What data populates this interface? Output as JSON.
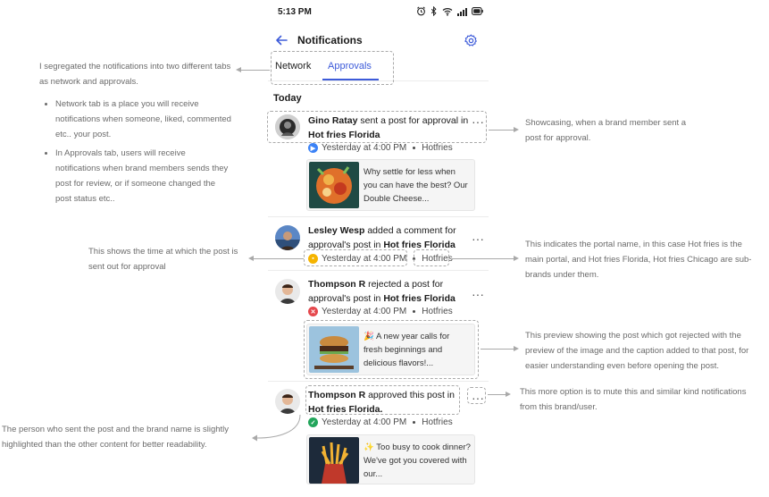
{
  "status_bar": {
    "time": "5:13 PM"
  },
  "header": {
    "title": "Notifications"
  },
  "tabs": [
    {
      "label": "Network"
    },
    {
      "label": "Approvals"
    }
  ],
  "section": {
    "label": "Today"
  },
  "notifications": [
    {
      "name": "Gino Ratay",
      "text_mid": " sent a post for approval in ",
      "brand": "Hot fries Florida",
      "time": "Yesterday at 4:00 PM",
      "portal": "Hotfries",
      "preview": "Why settle for less when you can have the best? Our Double Cheese..."
    },
    {
      "name": "Lesley Wesp",
      "text_mid": " added a comment for approval's post in ",
      "brand": "Hot fries Florida",
      "time": "Yesterday at 4:00 PM",
      "portal": "Hotfries"
    },
    {
      "name": "Thompson R",
      "text_mid": " rejected a post for approval's post in ",
      "brand": "Hot fries Florida",
      "time": "Yesterday at 4:00 PM",
      "portal": "Hotfries",
      "preview": "🎉 A new year calls for fresh beginnings and delicious flavors!..."
    },
    {
      "name": "Thompson R",
      "text_mid": " approved this post in ",
      "brand": "Hot fries Florida.",
      "time": "Yesterday at 4:00 PM",
      "portal": "Hotfries",
      "preview": "✨ Too busy to cook dinner? We've got you covered with our..."
    }
  ],
  "annotations": {
    "tabs_intro": "I segregated the notifications into two different tabs as network and approvals.",
    "tabs_bullet_1": "Network tab is a place you will receive notifications when someone, liked, commented etc.. your post.",
    "tabs_bullet_2": "In Approvals tab, users will receive notifications when brand members sends they post for review, or if someone changed the post status etc..",
    "showcasing": "Showcasing, when a brand member sent a post for approval.",
    "time_note": "This shows the time at which the post is sent out for approval",
    "portal_note": "This indicates the portal name, in this case Hot fries is the main portal, and Hot fries Florida, Hot fries Chicago are sub-brands under them.",
    "preview_note": "This preview showing the post which got rejected with the preview of the image and the caption added to that post, for easier understanding even before opening the post.",
    "more_note": "This more option is to mute this and similar kind notifications from this brand/user.",
    "sender_note": "The person who sent the post and the brand name is slightly highlighted than the other content for better readability."
  },
  "colors": {
    "accent": "#3d5bd9",
    "status_blue": "#3b82f6",
    "status_yellow": "#f5b400",
    "status_red": "#e5484d",
    "status_green": "#22a55b"
  }
}
